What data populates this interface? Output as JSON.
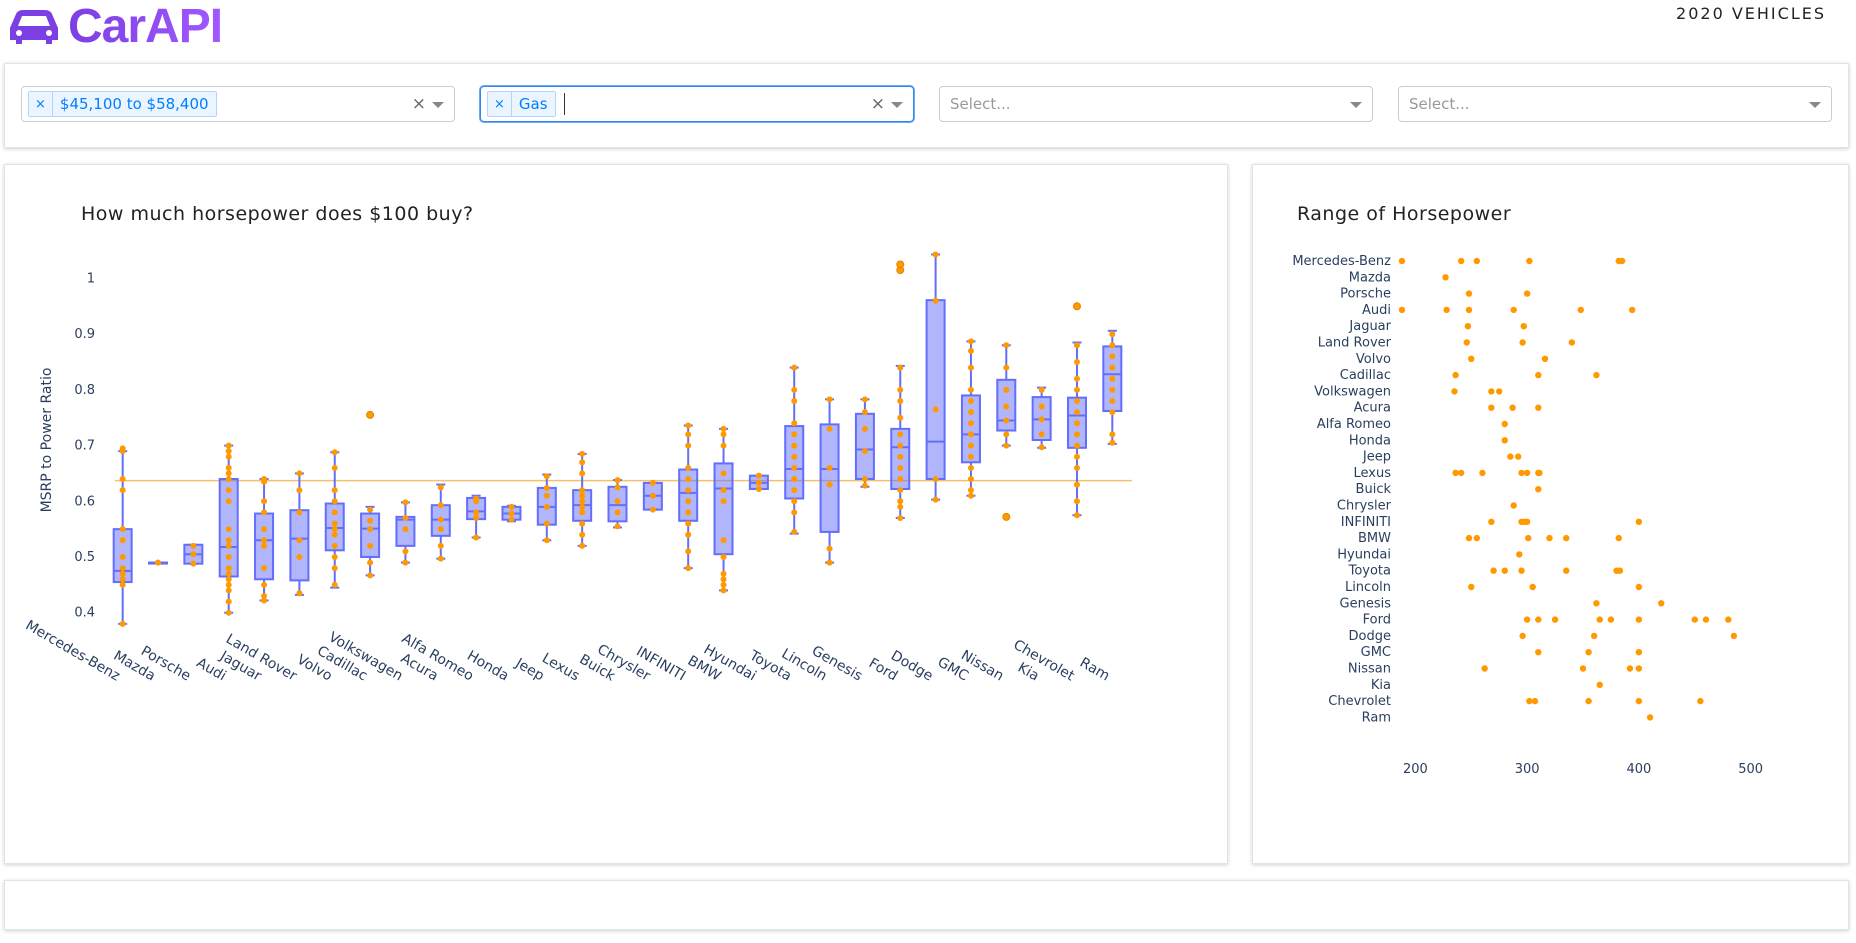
{
  "header": {
    "logo_text": "CarAPI",
    "page_label": "2020 VEHICLES",
    "brand_color": "#7b3fe4"
  },
  "filters": [
    {
      "value": "$45,100 to $58,400",
      "placeholder": ""
    },
    {
      "value": "Gas",
      "placeholder": ""
    },
    {
      "value": "",
      "placeholder": "Select..."
    },
    {
      "value": "",
      "placeholder": "Select..."
    }
  ],
  "chart_data": [
    {
      "type": "box",
      "title": "How much horsepower does $100 buy?",
      "ylabel": "MSRP to Power Ratio",
      "ylim": [
        0.36,
        1.06
      ],
      "yticks": [
        0.4,
        0.5,
        0.6,
        0.7,
        0.8,
        0.9,
        1
      ],
      "reference_line": 0.637,
      "box_color": "#636efa",
      "point_color": "#ff9900",
      "categories": [
        "Mercedes-Benz",
        "Mazda",
        "Porsche",
        "Audi",
        "Jaguar",
        "Land Rover",
        "Volvo",
        "Cadillac",
        "Volkswagen",
        "Acura",
        "Alfa Romeo",
        "Honda",
        "Jeep",
        "Lexus",
        "Buick",
        "Chrysler",
        "INFINITI",
        "BMW",
        "Hyundai",
        "Toyota",
        "Lincoln",
        "Genesis",
        "Ford",
        "Dodge",
        "GMC",
        "Nissan",
        "Kia",
        "Chevrolet",
        "Ram"
      ],
      "boxes": [
        {
          "min": 0.38,
          "q1": 0.455,
          "median": 0.475,
          "q3": 0.55,
          "max": 0.69,
          "outliers": [],
          "points": [
            0.38,
            0.45,
            0.46,
            0.47,
            0.48,
            0.5,
            0.53,
            0.55,
            0.62,
            0.64,
            0.69,
            0.695
          ]
        },
        {
          "min": 0.49,
          "q1": 0.49,
          "median": 0.49,
          "q3": 0.49,
          "max": 0.49,
          "outliers": [],
          "points": [
            0.49,
            0.49
          ]
        },
        {
          "min": 0.488,
          "q1": 0.488,
          "median": 0.505,
          "q3": 0.522,
          "max": 0.522,
          "outliers": [],
          "points": [
            0.488,
            0.505,
            0.52
          ]
        },
        {
          "min": 0.4,
          "q1": 0.465,
          "median": 0.518,
          "q3": 0.64,
          "max": 0.7,
          "outliers": [],
          "points": [
            0.4,
            0.42,
            0.44,
            0.45,
            0.46,
            0.47,
            0.48,
            0.5,
            0.52,
            0.53,
            0.55,
            0.6,
            0.62,
            0.64,
            0.65,
            0.66,
            0.68,
            0.69,
            0.7
          ]
        },
        {
          "min": 0.422,
          "q1": 0.46,
          "median": 0.53,
          "q3": 0.578,
          "max": 0.64,
          "outliers": [],
          "points": [
            0.422,
            0.43,
            0.45,
            0.48,
            0.52,
            0.53,
            0.55,
            0.58,
            0.6,
            0.635,
            0.64
          ]
        },
        {
          "min": 0.432,
          "q1": 0.458,
          "median": 0.533,
          "q3": 0.584,
          "max": 0.65,
          "outliers": [],
          "points": [
            0.435,
            0.5,
            0.53,
            0.58,
            0.62,
            0.65
          ]
        },
        {
          "min": 0.445,
          "q1": 0.512,
          "median": 0.552,
          "q3": 0.596,
          "max": 0.688,
          "outliers": [],
          "points": [
            0.45,
            0.48,
            0.5,
            0.52,
            0.54,
            0.55,
            0.56,
            0.58,
            0.6,
            0.62,
            0.66,
            0.688
          ]
        },
        {
          "min": 0.467,
          "q1": 0.5,
          "median": 0.551,
          "q3": 0.578,
          "max": 0.59,
          "outliers": [
            0.755
          ],
          "points": [
            0.467,
            0.49,
            0.52,
            0.55,
            0.565,
            0.585,
            0.755
          ]
        },
        {
          "min": 0.49,
          "q1": 0.52,
          "median": 0.567,
          "q3": 0.572,
          "max": 0.598,
          "outliers": [],
          "points": [
            0.49,
            0.51,
            0.55,
            0.57,
            0.598
          ]
        },
        {
          "min": 0.497,
          "q1": 0.538,
          "median": 0.567,
          "q3": 0.593,
          "max": 0.63,
          "outliers": [],
          "points": [
            0.497,
            0.52,
            0.55,
            0.567,
            0.593,
            0.625
          ]
        },
        {
          "min": 0.535,
          "q1": 0.568,
          "median": 0.582,
          "q3": 0.606,
          "max": 0.61,
          "outliers": [],
          "points": [
            0.535,
            0.57,
            0.58,
            0.6,
            0.605
          ]
        },
        {
          "min": 0.564,
          "q1": 0.567,
          "median": 0.578,
          "q3": 0.59,
          "max": 0.592,
          "outliers": [],
          "points": [
            0.567,
            0.578,
            0.59
          ]
        },
        {
          "min": 0.53,
          "q1": 0.558,
          "median": 0.59,
          "q3": 0.624,
          "max": 0.648,
          "outliers": [],
          "points": [
            0.53,
            0.56,
            0.59,
            0.61,
            0.624,
            0.645
          ]
        },
        {
          "min": 0.52,
          "q1": 0.565,
          "median": 0.593,
          "q3": 0.62,
          "max": 0.685,
          "outliers": [],
          "points": [
            0.52,
            0.54,
            0.56,
            0.58,
            0.59,
            0.6,
            0.61,
            0.62,
            0.65,
            0.67,
            0.685
          ]
        },
        {
          "min": 0.553,
          "q1": 0.564,
          "median": 0.593,
          "q3": 0.626,
          "max": 0.638,
          "outliers": [],
          "points": [
            0.555,
            0.58,
            0.6,
            0.625,
            0.638
          ]
        },
        {
          "min": 0.585,
          "q1": 0.585,
          "median": 0.61,
          "q3": 0.633,
          "max": 0.633,
          "outliers": [],
          "points": [
            0.585,
            0.61,
            0.633
          ]
        },
        {
          "min": 0.48,
          "q1": 0.565,
          "median": 0.615,
          "q3": 0.657,
          "max": 0.736,
          "outliers": [],
          "points": [
            0.48,
            0.51,
            0.54,
            0.56,
            0.58,
            0.6,
            0.62,
            0.64,
            0.66,
            0.7,
            0.72,
            0.736
          ]
        },
        {
          "min": 0.44,
          "q1": 0.505,
          "median": 0.623,
          "q3": 0.668,
          "max": 0.73,
          "outliers": [],
          "points": [
            0.44,
            0.45,
            0.46,
            0.47,
            0.5,
            0.53,
            0.6,
            0.62,
            0.65,
            0.7,
            0.72,
            0.73
          ]
        },
        {
          "min": 0.622,
          "q1": 0.622,
          "median": 0.633,
          "q3": 0.646,
          "max": 0.646,
          "outliers": [],
          "points": [
            0.622,
            0.633,
            0.646
          ]
        },
        {
          "min": 0.542,
          "q1": 0.605,
          "median": 0.658,
          "q3": 0.735,
          "max": 0.84,
          "outliers": [],
          "points": [
            0.545,
            0.58,
            0.6,
            0.62,
            0.64,
            0.66,
            0.68,
            0.7,
            0.72,
            0.74,
            0.78,
            0.8,
            0.84
          ]
        },
        {
          "min": 0.49,
          "q1": 0.545,
          "median": 0.658,
          "q3": 0.738,
          "max": 0.783,
          "outliers": [],
          "points": [
            0.49,
            0.515,
            0.63,
            0.66,
            0.73,
            0.783
          ]
        },
        {
          "min": 0.626,
          "q1": 0.64,
          "median": 0.693,
          "q3": 0.757,
          "max": 0.783,
          "outliers": [],
          "points": [
            0.628,
            0.64,
            0.69,
            0.73,
            0.76,
            0.783
          ]
        },
        {
          "min": 0.57,
          "q1": 0.622,
          "median": 0.697,
          "q3": 0.73,
          "max": 0.843,
          "outliers": [
            1.015,
            1.025
          ],
          "points": [
            0.57,
            0.59,
            0.6,
            0.62,
            0.64,
            0.66,
            0.68,
            0.7,
            0.72,
            0.75,
            0.78,
            0.8,
            0.84,
            1.015,
            1.025
          ]
        },
        {
          "min": 0.603,
          "q1": 0.64,
          "median": 0.707,
          "q3": 0.961,
          "max": 1.043,
          "outliers": [],
          "points": [
            0.603,
            0.64,
            0.765,
            0.96,
            1.043
          ]
        },
        {
          "min": 0.61,
          "q1": 0.67,
          "median": 0.72,
          "q3": 0.79,
          "max": 0.887,
          "outliers": [],
          "points": [
            0.61,
            0.62,
            0.64,
            0.66,
            0.68,
            0.7,
            0.72,
            0.74,
            0.76,
            0.78,
            0.8,
            0.84,
            0.87,
            0.887
          ]
        },
        {
          "min": 0.7,
          "q1": 0.727,
          "median": 0.745,
          "q3": 0.818,
          "max": 0.88,
          "outliers": [
            0.572
          ],
          "points": [
            0.572,
            0.7,
            0.72,
            0.745,
            0.77,
            0.8,
            0.84,
            0.88
          ]
        },
        {
          "min": 0.696,
          "q1": 0.71,
          "median": 0.747,
          "q3": 0.787,
          "max": 0.804,
          "outliers": [],
          "points": [
            0.697,
            0.72,
            0.747,
            0.77,
            0.8
          ]
        },
        {
          "min": 0.575,
          "q1": 0.696,
          "median": 0.754,
          "q3": 0.786,
          "max": 0.885,
          "outliers": [
            0.95
          ],
          "points": [
            0.575,
            0.6,
            0.63,
            0.66,
            0.68,
            0.7,
            0.72,
            0.74,
            0.76,
            0.78,
            0.8,
            0.82,
            0.85,
            0.88,
            0.95
          ]
        },
        {
          "min": 0.703,
          "q1": 0.762,
          "median": 0.828,
          "q3": 0.878,
          "max": 0.906,
          "outliers": [],
          "points": [
            0.705,
            0.72,
            0.76,
            0.78,
            0.8,
            0.82,
            0.84,
            0.86,
            0.88,
            0.9
          ]
        }
      ]
    },
    {
      "type": "scatter",
      "title": "Range of Horsepower",
      "xlim": [
        180,
        520
      ],
      "xticks": [
        200,
        300,
        400,
        500
      ],
      "point_color": "#ff9900",
      "categories": [
        "Mercedes-Benz",
        "Mazda",
        "Porsche",
        "Audi",
        "Jaguar",
        "Land Rover",
        "Volvo",
        "Cadillac",
        "Volkswagen",
        "Acura",
        "Alfa Romeo",
        "Honda",
        "Jeep",
        "Lexus",
        "Buick",
        "Chrysler",
        "INFINITI",
        "BMW",
        "Hyundai",
        "Toyota",
        "Lincoln",
        "Genesis",
        "Ford",
        "Dodge",
        "GMC",
        "Nissan",
        "Kia",
        "Chevrolet",
        "Ram"
      ],
      "points": [
        [
          188,
          241,
          255,
          302,
          382,
          385
        ],
        [
          227
        ],
        [
          248,
          300
        ],
        [
          188,
          228,
          248,
          288,
          348,
          394
        ],
        [
          247,
          297
        ],
        [
          246,
          296,
          340
        ],
        [
          250,
          316
        ],
        [
          236,
          310,
          362
        ],
        [
          235,
          268,
          275
        ],
        [
          268,
          287,
          310
        ],
        [
          280
        ],
        [
          280
        ],
        [
          285,
          292
        ],
        [
          236,
          241,
          260,
          295,
          300,
          310,
          311
        ],
        [
          310
        ],
        [
          288
        ],
        [
          268,
          295,
          298,
          300,
          400
        ],
        [
          248,
          255,
          301,
          320,
          335,
          382
        ],
        [
          293
        ],
        [
          270,
          280,
          295,
          335,
          380,
          383
        ],
        [
          250,
          305,
          400
        ],
        [
          362,
          420
        ],
        [
          300,
          310,
          325,
          365,
          375,
          400,
          450,
          460,
          480
        ],
        [
          296,
          360,
          485
        ],
        [
          310,
          355,
          400
        ],
        [
          262,
          350,
          392,
          400
        ],
        [
          365
        ],
        [
          302,
          307,
          355,
          400,
          455
        ],
        [
          410
        ]
      ]
    }
  ]
}
